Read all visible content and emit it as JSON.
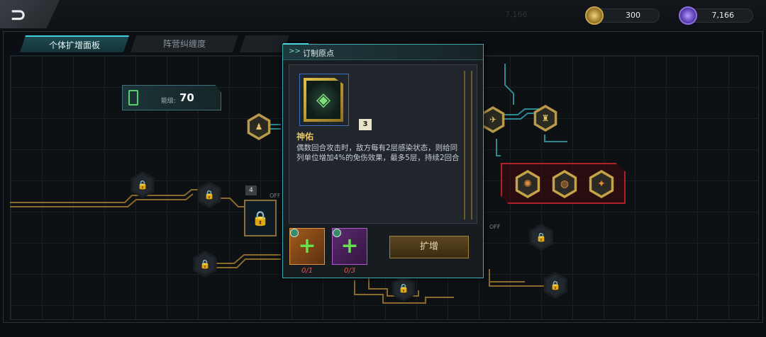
{
  "top_bar": {
    "back_icon": "back-arrow-icon",
    "gold_amount": "300",
    "gem_amount": "7,166",
    "faint_amount": "7,166"
  },
  "tabs": [
    {
      "label": "个体扩增面板",
      "active": true
    },
    {
      "label": "阵营纠缠度",
      "active": false
    },
    {
      "label": "",
      "active": false
    }
  ],
  "energy": {
    "label": "能级:",
    "value": "70"
  },
  "nodes": {
    "badge_4": "4",
    "off_left": "OFF",
    "off_right": "OFF"
  },
  "popup": {
    "header_chevron": ">>",
    "title": "订制原点",
    "level": "3",
    "skill_name": "神佑",
    "skill_desc": "偶数回合攻击时，敌方每有2层感染状态，则给同列单位增加4%的免伤效果，最多5层，持续2回合",
    "materials": [
      {
        "count": "0/1",
        "color": "#a45a1c"
      },
      {
        "count": "0/3",
        "color": "#5c2a6e"
      }
    ],
    "expand_label": "扩增"
  },
  "colors": {
    "accent": "#3fd0d8",
    "gold": "#e3c46a",
    "red_group": "#b0222a",
    "material_count": "#e0564c"
  }
}
